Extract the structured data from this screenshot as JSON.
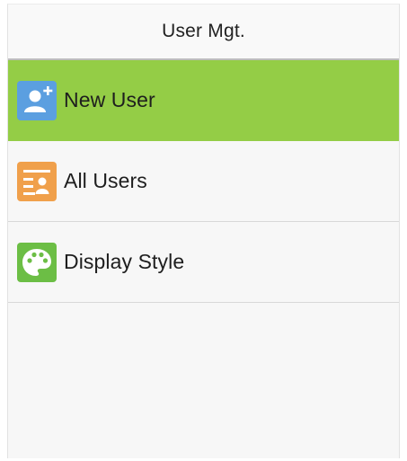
{
  "header": {
    "title": "User Mgt."
  },
  "menu": {
    "items": [
      {
        "label": "New User",
        "icon": "add-user-icon",
        "selected": true,
        "icon_color": "#5b9fe0"
      },
      {
        "label": "All Users",
        "icon": "user-list-icon",
        "selected": false,
        "icon_color": "#f0a04b"
      },
      {
        "label": "Display Style",
        "icon": "palette-icon",
        "selected": false,
        "icon_color": "#6cbe45"
      }
    ]
  },
  "colors": {
    "selected_background": "#94cd46",
    "header_divider": "#bdbdbd"
  }
}
